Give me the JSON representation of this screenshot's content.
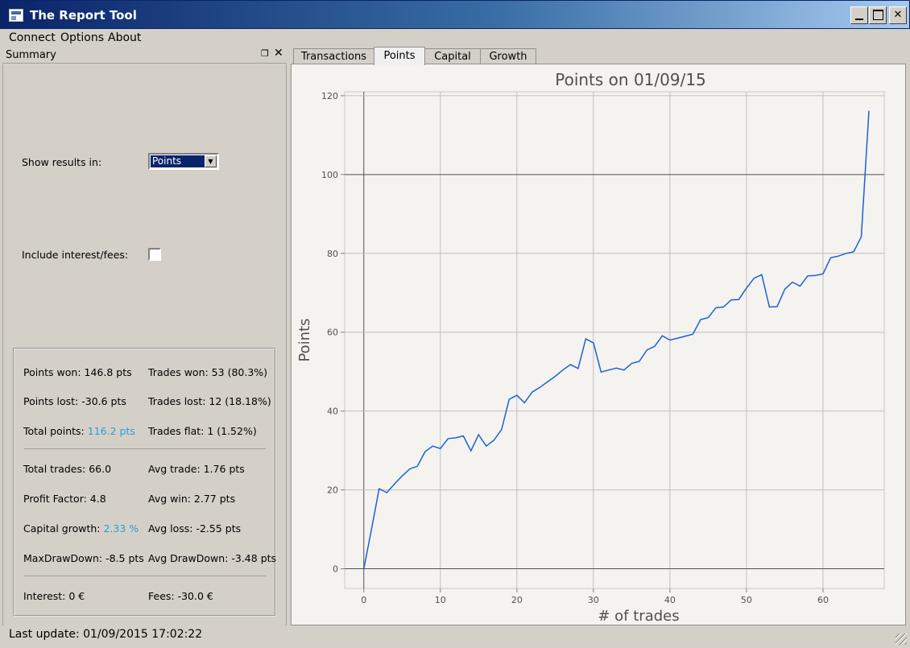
{
  "window": {
    "title": "The Report Tool"
  },
  "menu": {
    "items": [
      "Connect",
      "Options",
      "About"
    ]
  },
  "dock": {
    "title": "Summary",
    "show_results_label": "Show results in:",
    "show_results_value": "Points",
    "include_fees_label": "Include interest/fees:",
    "include_fees_checked": false
  },
  "stats": {
    "points_won": "Points won: 146.8 pts",
    "trades_won": "Trades won: 53 (80.3%)",
    "points_lost": "Points lost: -30.6 pts",
    "trades_lost": "Trades lost: 12 (18.18%)",
    "total_points_label": "Total points: ",
    "total_points_value": "116.2 pts",
    "trades_flat": "Trades flat: 1 (1.52%)",
    "total_trades": "Total trades: 66.0",
    "avg_trade": "Avg trade: 1.76 pts",
    "profit_factor": "Profit Factor: 4.8",
    "avg_win": "Avg win: 2.77 pts",
    "capital_growth_label": "Capital growth: ",
    "capital_growth_value": "2.33 %",
    "avg_loss": "Avg loss: -2.55 pts",
    "max_drawdown": "MaxDrawDown: -8.5 pts",
    "avg_drawdown": "Avg DrawDown: -3.48 pts",
    "interest": "Interest: 0 €",
    "fees": "Fees: -30.0 €"
  },
  "tabs": [
    "Transactions",
    "Points",
    "Capital",
    "Growth"
  ],
  "active_tab": "Points",
  "status": {
    "last_update": "Last update: 01/09/2015 17:02:22"
  },
  "colors": {
    "line": "#1f5fd6",
    "highlight": "#2a9fd6"
  },
  "chart_data": {
    "type": "line",
    "title": "Points on 01/09/15",
    "xlabel": "# of trades",
    "ylabel": "Points",
    "xlim": [
      -2.5,
      68
    ],
    "ylim": [
      -5,
      121
    ],
    "xticks": [
      0,
      10,
      20,
      30,
      40,
      50,
      60
    ],
    "yticks": [
      0,
      20,
      40,
      60,
      80,
      100,
      120
    ],
    "grid": true,
    "series": [
      {
        "x": [
          0,
          1,
          2,
          3,
          4,
          5,
          6,
          7,
          8,
          9,
          10,
          11,
          12,
          13,
          14,
          15,
          16,
          17,
          18,
          19,
          20,
          21,
          22,
          23,
          24,
          25,
          26,
          27,
          28,
          29,
          30,
          31,
          32,
          33,
          34,
          35,
          36,
          37,
          38,
          39,
          40,
          41,
          42,
          43,
          44,
          45,
          46,
          47,
          48,
          49,
          50,
          51,
          52,
          53,
          54,
          55,
          56,
          57,
          58,
          59,
          60,
          61,
          62,
          63,
          64,
          65,
          66
        ],
        "y": [
          0,
          10,
          20.3,
          19.3,
          21.5,
          23.5,
          25.3,
          26,
          29.7,
          31.1,
          30.5,
          33,
          33.2,
          33.7,
          29.9,
          34,
          31.1,
          32.6,
          35.3,
          43,
          44,
          42.1,
          44.8,
          46,
          47.4,
          48.8,
          50.4,
          51.8,
          50.8,
          58.3,
          57.3,
          49.9,
          50.4,
          50.9,
          50.4,
          52.1,
          52.6,
          55.5,
          56.4,
          59.1,
          58,
          58.5,
          59,
          59.5,
          63.2,
          63.7,
          66.2,
          66.4,
          68.2,
          68.3,
          71.2,
          73.7,
          74.6,
          66.4,
          66.5,
          70.9,
          72.7,
          71.7,
          74.3,
          74.4,
          74.8,
          78.9,
          79.3,
          80,
          80.4,
          84.2,
          116.2
        ]
      }
    ]
  }
}
